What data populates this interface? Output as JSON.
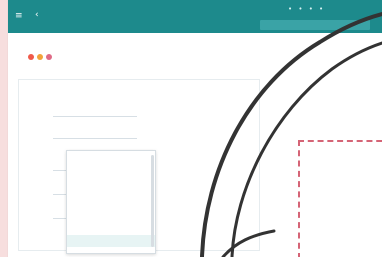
{
  "colors": {
    "background": "#f7dede",
    "topbar": "#1d8a8c",
    "accent": "#2e9ea1",
    "dashed_panel": "#d56476"
  },
  "icons": {
    "menu": "menu-icon",
    "back": "back-icon",
    "toolbar": [
      "red-dot-icon",
      "orange-dot-icon",
      "pink-dot-icon"
    ]
  },
  "header": {
    "breadcrumb": "",
    "title": "",
    "title_actions": ""
  },
  "form": {
    "section_label": "",
    "fields": [
      {
        "label": "",
        "value": ""
      },
      {
        "label": "",
        "value": ""
      },
      {
        "label": "",
        "value": ""
      },
      {
        "label": "",
        "value": ""
      },
      {
        "label": "",
        "value": ""
      }
    ],
    "dropdown": {
      "items": [
        "",
        "",
        "",
        "",
        "",
        "",
        "",
        ""
      ],
      "selected_index": 7
    }
  },
  "middle": {
    "labels": [
      "",
      "",
      "",
      ""
    ]
  },
  "side_panel": {
    "title": "",
    "subtitle": "",
    "items": [
      "",
      "",
      "",
      ""
    ]
  }
}
